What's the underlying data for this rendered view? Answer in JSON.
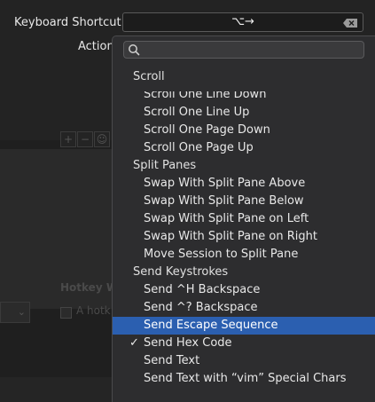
{
  "form": {
    "keyboard_shortcut_label": "Keyboard Shortcut",
    "shortcut_value": "⌥→",
    "action_label": "Action"
  },
  "background": {
    "hotkey_label": "Hotkey W",
    "hotkey_checkbox_label": "A hotk"
  },
  "menu": {
    "search_placeholder": "",
    "sections": [
      {
        "header": "Scroll",
        "items": [
          {
            "label": "Scroll One Line Down"
          },
          {
            "label": "Scroll One Line Up"
          },
          {
            "label": "Scroll One Page Down"
          },
          {
            "label": "Scroll One Page Up"
          }
        ]
      },
      {
        "header": "Split Panes",
        "items": [
          {
            "label": "Swap With Split Pane Above"
          },
          {
            "label": "Swap With Split Pane Below"
          },
          {
            "label": "Swap With Split Pane on Left"
          },
          {
            "label": "Swap With Split Pane on Right"
          },
          {
            "label": "Move Session to Split Pane"
          }
        ]
      },
      {
        "header": "Send Keystrokes",
        "items": [
          {
            "label": "Send ^H Backspace"
          },
          {
            "label": "Send ^? Backspace"
          },
          {
            "label": "Send Escape Sequence",
            "highlighted": true
          },
          {
            "label": "Send Hex Code",
            "checked": true
          },
          {
            "label": "Send Text"
          },
          {
            "label": "Send Text with “vim” Special Chars"
          }
        ]
      }
    ]
  },
  "colors": {
    "highlight": "#2b5fb0",
    "menu_bg": "#2d2d2f",
    "window_bg": "#262626"
  }
}
